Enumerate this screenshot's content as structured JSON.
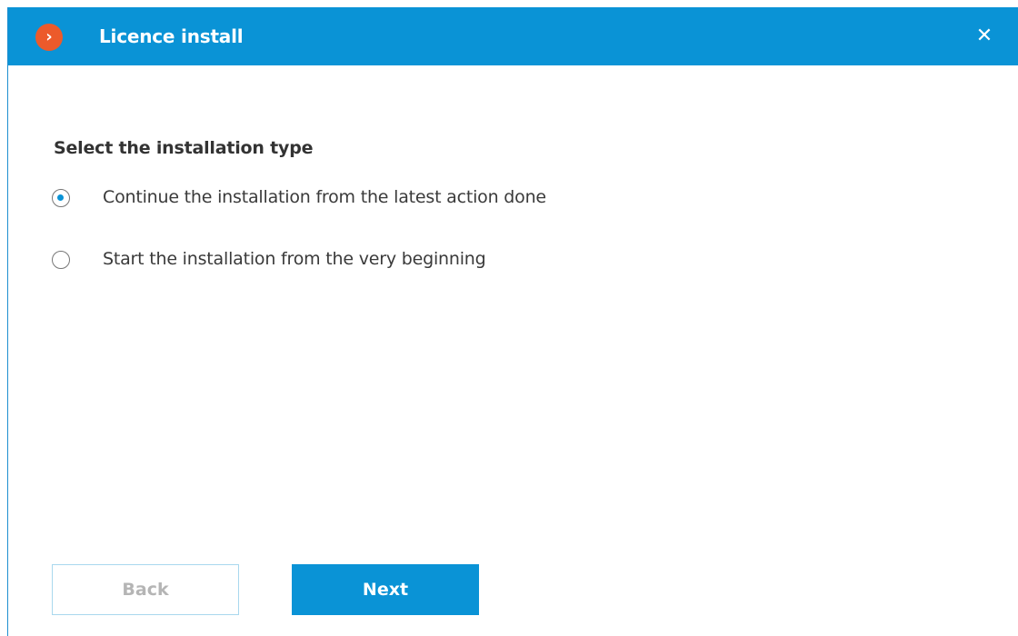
{
  "window": {
    "title": "Licence install",
    "app_icon": "chevron-right-icon",
    "close_glyph": "✕"
  },
  "main": {
    "section_title": "Select the installation type",
    "options": [
      {
        "label": "Continue the installation from the latest action done",
        "selected": true
      },
      {
        "label": "Start the installation from the very beginning",
        "selected": false
      }
    ]
  },
  "footer": {
    "back_label": "Back",
    "next_label": "Next"
  },
  "colors": {
    "accent": "#0a93d6",
    "brand_icon": "#ec5a2b",
    "back_border": "#a9d8ee",
    "disabled_text": "#b5b5b5"
  }
}
